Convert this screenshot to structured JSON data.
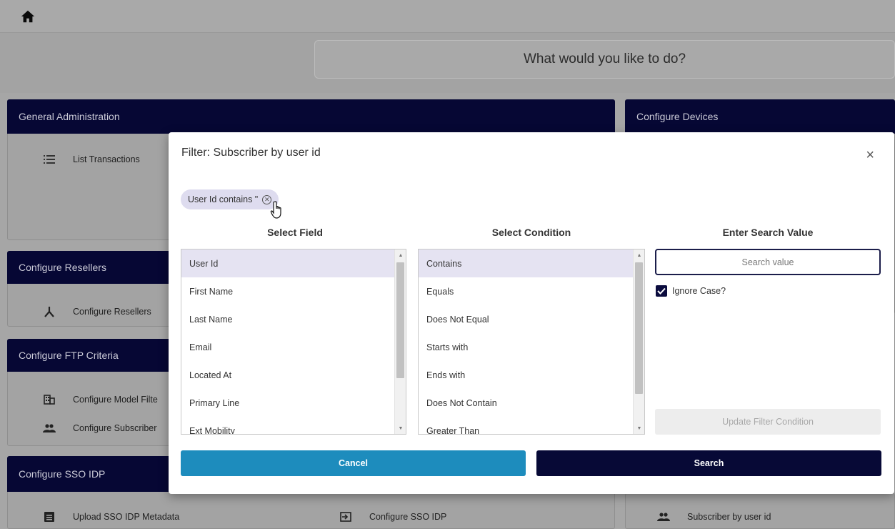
{
  "header": {
    "home_icon": "home-icon"
  },
  "prompt": {
    "text": "What would you like to do?"
  },
  "background": {
    "general_admin": {
      "title": "General Administration",
      "items": [
        {
          "label": "List Transactions",
          "icon": "list-icon"
        }
      ]
    },
    "configure_devices": {
      "title": "Configure Devices"
    },
    "configure_resellers": {
      "title": "Configure Resellers",
      "items": [
        {
          "label": "Configure Resellers",
          "icon": "hierarchy-icon"
        }
      ]
    },
    "configure_ftp": {
      "title": "Configure FTP Criteria",
      "items": [
        {
          "label": "Configure Model Filte",
          "icon": "building-icon"
        },
        {
          "label": "Configure Subscriber",
          "icon": "people-icon"
        }
      ]
    },
    "configure_sso": {
      "title": "Configure SSO IDP",
      "items": [
        {
          "label": "Upload SSO IDP Metadata",
          "icon": "upload-doc-icon"
        },
        {
          "label": "Configure SSO IDP",
          "icon": "login-icon"
        }
      ]
    },
    "right_bottom": {
      "items": [
        {
          "label": "Subscriber by user id",
          "icon": "people-icon"
        }
      ]
    }
  },
  "modal": {
    "title": "Filter: Subscriber by user id",
    "chip_label": "User Id contains \"",
    "field_header": "Select Field",
    "condition_header": "Select Condition",
    "value_header": "Enter Search Value",
    "fields": [
      "User Id",
      "First Name",
      "Last Name",
      "Email",
      "Located At",
      "Primary Line",
      "Ext Mobility"
    ],
    "selected_field": "User Id",
    "conditions": [
      "Contains",
      "Equals",
      "Does Not Equal",
      "Starts with",
      "Ends with",
      "Does Not Contain",
      "Greater Than"
    ],
    "selected_condition": "Contains",
    "search_placeholder": "Search value",
    "search_value": "",
    "ignore_case_label": "Ignore Case?",
    "ignore_case_checked": true,
    "update_label": "Update Filter Condition",
    "cancel_label": "Cancel",
    "search_label": "Search"
  },
  "colors": {
    "navy": "#070936",
    "blue": "#1d8cbd",
    "selected_row": "#e5e3f2"
  }
}
